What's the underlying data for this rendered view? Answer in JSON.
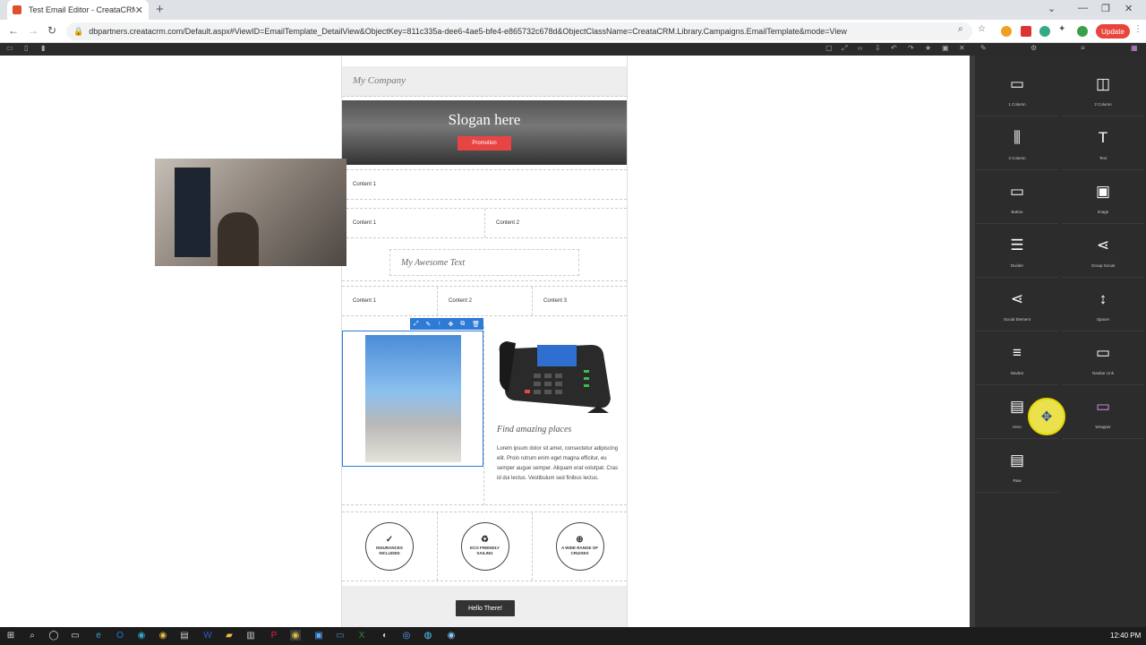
{
  "browser": {
    "tab_title": "Test Email Editor - CreataCRM",
    "url": "dbpartners.creatacrm.com/Default.aspx#ViewID=EmailTemplate_DetailView&ObjectKey=811c335a-dee6-4ae5-bfe4-e865732c678d&ObjectClassName=CreataCRM.Library.Campaigns.EmailTemplate&mode=View",
    "update_label": "Update"
  },
  "canvas": {
    "company": "My Company",
    "slogan": "Slogan here",
    "promotion": "Promotion",
    "row1": [
      "Content 1"
    ],
    "row2": [
      "Content 1",
      "Content 2"
    ],
    "awesome_text": "My Awesome Text",
    "row3": [
      "Content 1",
      "Content 2",
      "Content 3"
    ],
    "find_title": "Find amazing places",
    "lorem": "Lorem ipsum dolor sit amet, consectetur adipiscing elit. Proin rutrum enim eget magna efficitur, eu semper augue semper. Aliquam erat volutpat. Cras id dui lectus. Vestibulum sed finibus lectus.",
    "features": [
      "INSURANCES INCLUDED",
      "ECO FRIENDLY SAILING",
      "A WIDE RANGE OF CRUISES"
    ],
    "button": "Hello There!"
  },
  "panel": {
    "blocks": [
      {
        "label": "1 Column",
        "icon": "one-column-icon"
      },
      {
        "label": "2 Column",
        "icon": "two-column-icon"
      },
      {
        "label": "3 Column",
        "icon": "three-column-icon"
      },
      {
        "label": "Text",
        "icon": "text-icon"
      },
      {
        "label": "Button",
        "icon": "button-icon"
      },
      {
        "label": "Image",
        "icon": "image-icon"
      },
      {
        "label": "Divider",
        "icon": "divider-icon"
      },
      {
        "label": "Group Social",
        "icon": "group-social-icon"
      },
      {
        "label": "Social Element",
        "icon": "social-element-icon"
      },
      {
        "label": "Spacer",
        "icon": "spacer-icon"
      },
      {
        "label": "Navbar",
        "icon": "navbar-icon"
      },
      {
        "label": "Navbar Link",
        "icon": "navbar-link-icon"
      },
      {
        "label": "Hero",
        "icon": "hero-icon"
      },
      {
        "label": "Wrapper",
        "icon": "wrapper-icon"
      },
      {
        "label": "Raw",
        "icon": "raw-icon"
      }
    ]
  },
  "taskbar": {
    "time": "12:40 PM"
  },
  "colors": {
    "accent": "#2d7bd4",
    "promo": "#e84444",
    "panel": "#2c2c2c"
  }
}
